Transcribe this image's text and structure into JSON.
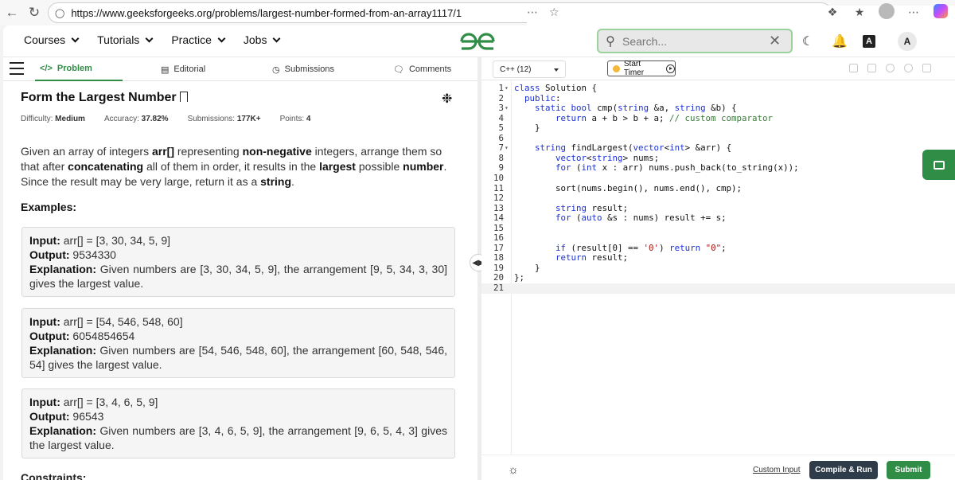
{
  "browser": {
    "url": "https://www.geeksforgeeks.org/problems/largest-number-formed-from-an-array1117/1"
  },
  "nav": {
    "menu": [
      "Courses",
      "Tutorials",
      "Practice",
      "Jobs"
    ],
    "search_placeholder": "Search...",
    "user_initial": "A"
  },
  "tabs": [
    "Problem",
    "Editorial",
    "Submissions",
    "Comments"
  ],
  "problem": {
    "title": "Form the Largest Number",
    "difficulty_label": "Difficulty:",
    "difficulty": "Medium",
    "accuracy_label": "Accuracy:",
    "accuracy": "37.82%",
    "submissions_label": "Submissions:",
    "submissions": "177K+",
    "points_label": "Points:",
    "points": "4",
    "statement": {
      "p1": "Given an array of integers ",
      "b1": "arr[]",
      "p2": " representing ",
      "b2": "non-negative",
      "p3": " integers, arrange them so that after ",
      "b3": "concatenating",
      "p4": " all of them in order, it results in the ",
      "b4": "largest",
      "p5": " possible ",
      "b5": "number",
      "p6": ". Since the result may be very large, return it as a ",
      "b6": "string",
      "p7": "."
    },
    "examples_heading": "Examples:",
    "labels": {
      "input": "Input:",
      "output": "Output:",
      "explanation": "Explanation:"
    },
    "examples": [
      {
        "input": "arr[]  =  [3,  30,  34,  5,  9]",
        "output": "9534330",
        "explanation": "Given  numbers  are  [3,  30,  34,  5,  9],  the  arrangement  [9,  5,  34,  3,  30]  gives  the  largest  value."
      },
      {
        "input": "arr[]  =  [54,  546,  548,  60]",
        "output": "6054854654",
        "explanation": "Given  numbers  are  [54,  546,  548,  60],  the  arrangement  [60,  548,  546,  54]  gives  the  largest  value."
      },
      {
        "input": "arr[]  =  [3,  4,  6,  5,  9]",
        "output": "96543",
        "explanation": "Given  numbers  are  [3,  4,  6,  5,  9],  the  arrangement  [9,  6,  5,  4,  3]  gives  the  largest  value."
      }
    ],
    "constraints_heading": "Constraints:"
  },
  "editor": {
    "language": "C++ (12)",
    "timer_label": "Start Timer",
    "lines": [
      "class Solution {",
      "  public:",
      "    static bool cmp(string &a, string &b) {",
      "        return a + b > b + a; // custom comparator",
      "    }",
      "",
      "    string findLargest(vector<int> &arr) {",
      "        vector<string> nums;",
      "        for (int x : arr) nums.push_back(to_string(x));",
      "",
      "        sort(nums.begin(), nums.end(), cmp);",
      "",
      "        string result;",
      "        for (auto &s : nums) result += s;",
      "",
      "",
      "        if (result[0] == '0') return \"0\";",
      "        return result;",
      "    }",
      "};",
      ""
    ],
    "fold_lines": [
      1,
      3,
      7
    ],
    "custom_input": "Custom Input",
    "compile_run": "Compile & Run",
    "submit": "Submit"
  }
}
